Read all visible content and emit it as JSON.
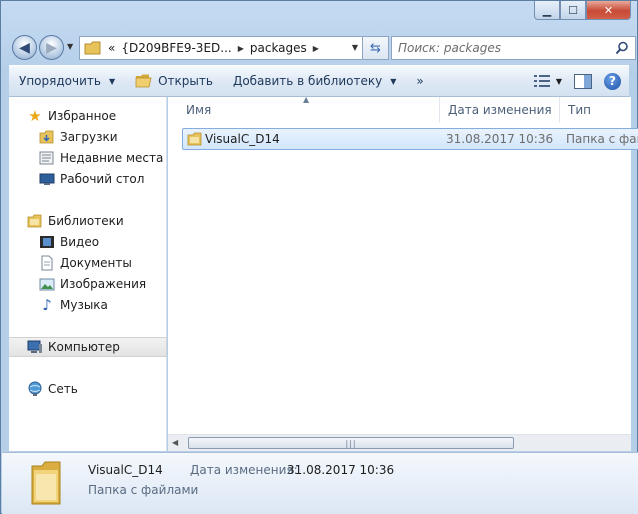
{
  "address": {
    "prefix": "«",
    "segments": [
      "{D209BFE9-3ED...",
      "packages"
    ]
  },
  "search": {
    "placeholder": "Поиск: packages"
  },
  "toolbar": {
    "organize": "Упорядочить",
    "open": "Открыть",
    "add_library": "Добавить в библиотеку",
    "more": "»"
  },
  "sidebar": {
    "favorites": "Избранное",
    "downloads": "Загрузки",
    "recent": "Недавние места",
    "desktop": "Рабочий стол",
    "libraries": "Библиотеки",
    "video": "Видео",
    "documents": "Документы",
    "images": "Изображения",
    "music": "Музыка",
    "computer": "Компьютер",
    "network": "Сеть"
  },
  "columns": {
    "name": "Имя",
    "date": "Дата изменения",
    "type": "Тип"
  },
  "files": [
    {
      "name": "VisualC_D14",
      "date": "31.08.2017 10:36",
      "type": "Папка с фай"
    }
  ],
  "details": {
    "name": "VisualC_D14",
    "type": "Папка с файлами",
    "date_label": "Дата изменения:",
    "date": "31.08.2017 10:36"
  },
  "colors": {
    "selection": "#d3e6fb",
    "accent": "#1e395b",
    "folder": "#e8c25a"
  }
}
